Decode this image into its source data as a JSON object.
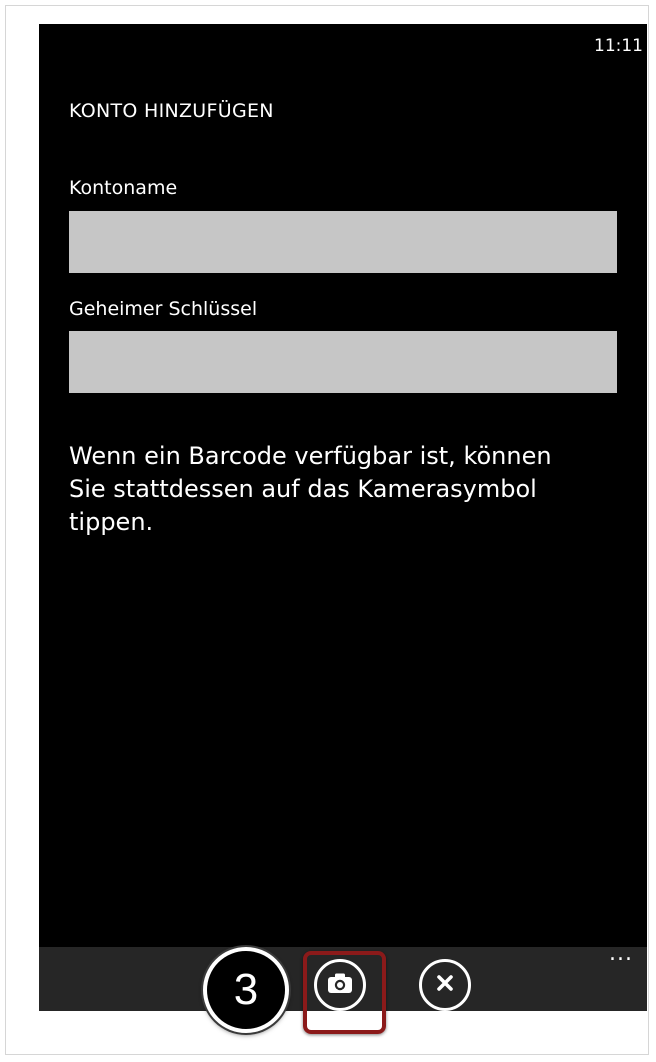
{
  "status_bar": {
    "time": "11:11"
  },
  "page": {
    "title": "KONTO HINZUFÜGEN"
  },
  "form": {
    "account_name": {
      "label": "Kontoname",
      "value": ""
    },
    "secret_key": {
      "label": "Geheimer Schlüssel",
      "value": ""
    }
  },
  "hint": "Wenn ein Barcode verfügbar ist, können Sie stattdessen auf das Kamerasymbol tippen.",
  "app_bar": {
    "buttons": [
      {
        "icon": "camera-icon"
      },
      {
        "icon": "close-icon"
      }
    ],
    "more": "..."
  },
  "annotation": {
    "step_number": "3",
    "highlight_color": "#8b1a1a"
  },
  "colors": {
    "background": "#000000",
    "app_bar": "#262626",
    "input": "#c6c6c6",
    "text": "#ffffff"
  }
}
